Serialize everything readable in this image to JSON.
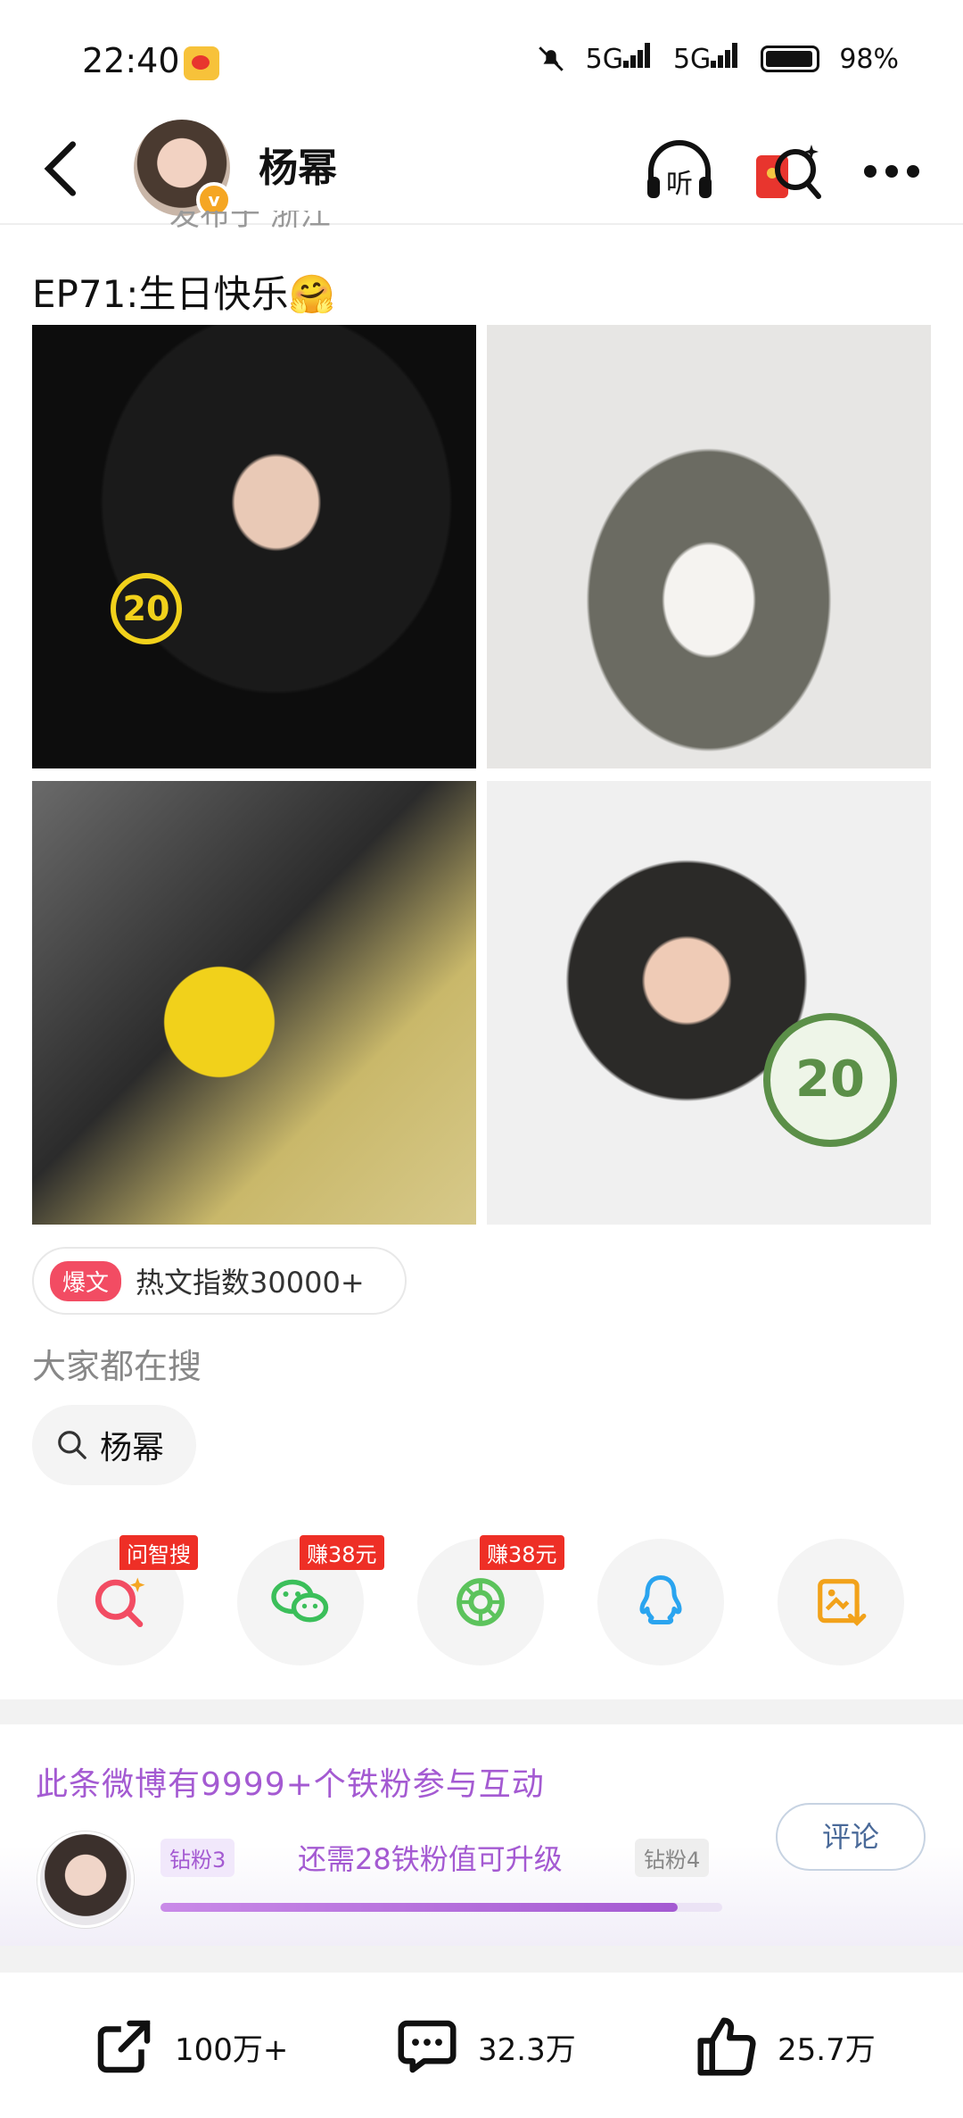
{
  "status": {
    "time": "22:40",
    "network1": "5G",
    "network2": "5G",
    "battery": "98%"
  },
  "nav": {
    "name": "杨幂",
    "listen_icon": "listen-icon",
    "redpacket_icon": "redpacket-search-icon",
    "more_icon": "more-icon"
  },
  "post": {
    "partial_text": "发布于 浙江",
    "title": "EP71:生日快乐🤗"
  },
  "images": [
    {
      "label": "20"
    },
    {
      "label": ""
    },
    {
      "label": ""
    },
    {
      "label": "20"
    }
  ],
  "hot": {
    "tag": "爆文",
    "text": "热文指数30000+"
  },
  "search": {
    "title": "大家都在搜",
    "chip": "杨幂"
  },
  "share_row": [
    {
      "name": "wenzhisou",
      "badge": "问智搜",
      "color": "#f24c63"
    },
    {
      "name": "wechat",
      "badge": "赚38元",
      "color": "#3bbf5a"
    },
    {
      "name": "moments",
      "badge": "赚38元",
      "color": "#5cc35c"
    },
    {
      "name": "qq",
      "badge": "",
      "color": "#2aa4ef"
    },
    {
      "name": "save-image",
      "badge": "",
      "color": "#f2a21a"
    }
  ],
  "fans": {
    "headline": "此条微博有9999+个铁粉参与互动",
    "level_current": "钻粉3",
    "level_next": "钻粉4",
    "need_text": "还需28铁粉值可升级",
    "progress": 0.92,
    "comment_btn": "评论"
  },
  "actions": {
    "share": "100万+",
    "comment": "32.3万",
    "like": "25.7万"
  }
}
